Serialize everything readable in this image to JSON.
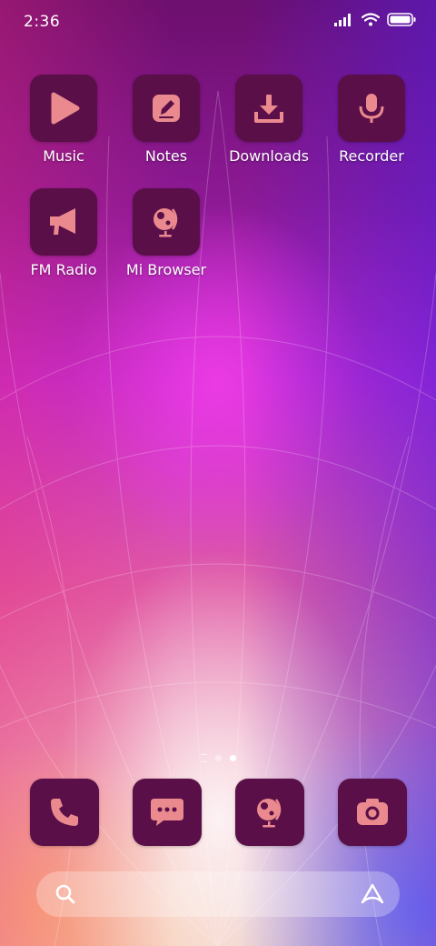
{
  "status_bar": {
    "time": "2:36",
    "icons": [
      "signal-icon",
      "wifi-icon",
      "battery-icon"
    ]
  },
  "apps": [
    {
      "label": "Music",
      "icon": "play-icon"
    },
    {
      "label": "Notes",
      "icon": "note-edit-icon"
    },
    {
      "label": "Downloads",
      "icon": "download-icon"
    },
    {
      "label": "Recorder",
      "icon": "microphone-icon"
    },
    {
      "label": "FM Radio",
      "icon": "megaphone-icon"
    },
    {
      "label": "Mi Browser",
      "icon": "globe-icon"
    }
  ],
  "page_indicator": {
    "pages": 3,
    "current": 3
  },
  "dock": [
    {
      "icon": "phone-icon"
    },
    {
      "icon": "chat-bubble-icon"
    },
    {
      "icon": "globe-icon"
    },
    {
      "icon": "camera-icon"
    }
  ],
  "search_bar": {
    "icons": [
      "search-icon",
      "assistant-icon"
    ]
  },
  "colors": {
    "icon_tile": "#5a0f48",
    "icon_glyph": "#ea8a8e",
    "label_text": "#ffffff"
  }
}
